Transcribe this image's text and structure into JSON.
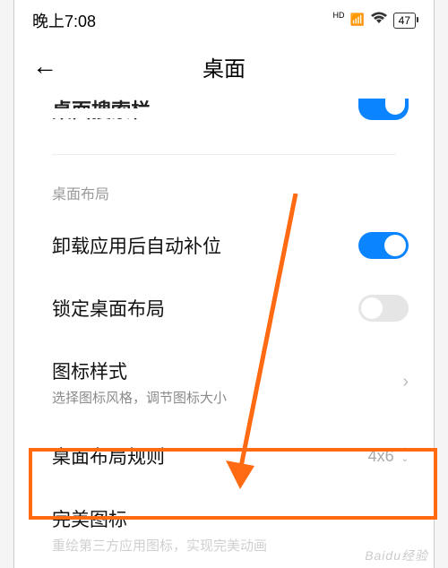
{
  "status": {
    "time": "晚上7:08",
    "hd": "HD",
    "battery": "47"
  },
  "header": {
    "title": "桌面"
  },
  "partial_row": {
    "label": "桌面搜索栏"
  },
  "section": {
    "header": "桌面布局"
  },
  "rows": {
    "auto_fill": {
      "title": "卸载应用后自动补位"
    },
    "lock_layout": {
      "title": "锁定桌面布局"
    },
    "icon_style": {
      "title": "图标样式",
      "desc": "选择图标风格，调节图标大小"
    },
    "layout_rule": {
      "title": "桌面布局规则",
      "value": "4x6"
    },
    "perfect_icon": {
      "title": "完美图标",
      "desc": "重绘第三方应用图标，实现完美动画"
    }
  },
  "watermark": "Baidu经验"
}
